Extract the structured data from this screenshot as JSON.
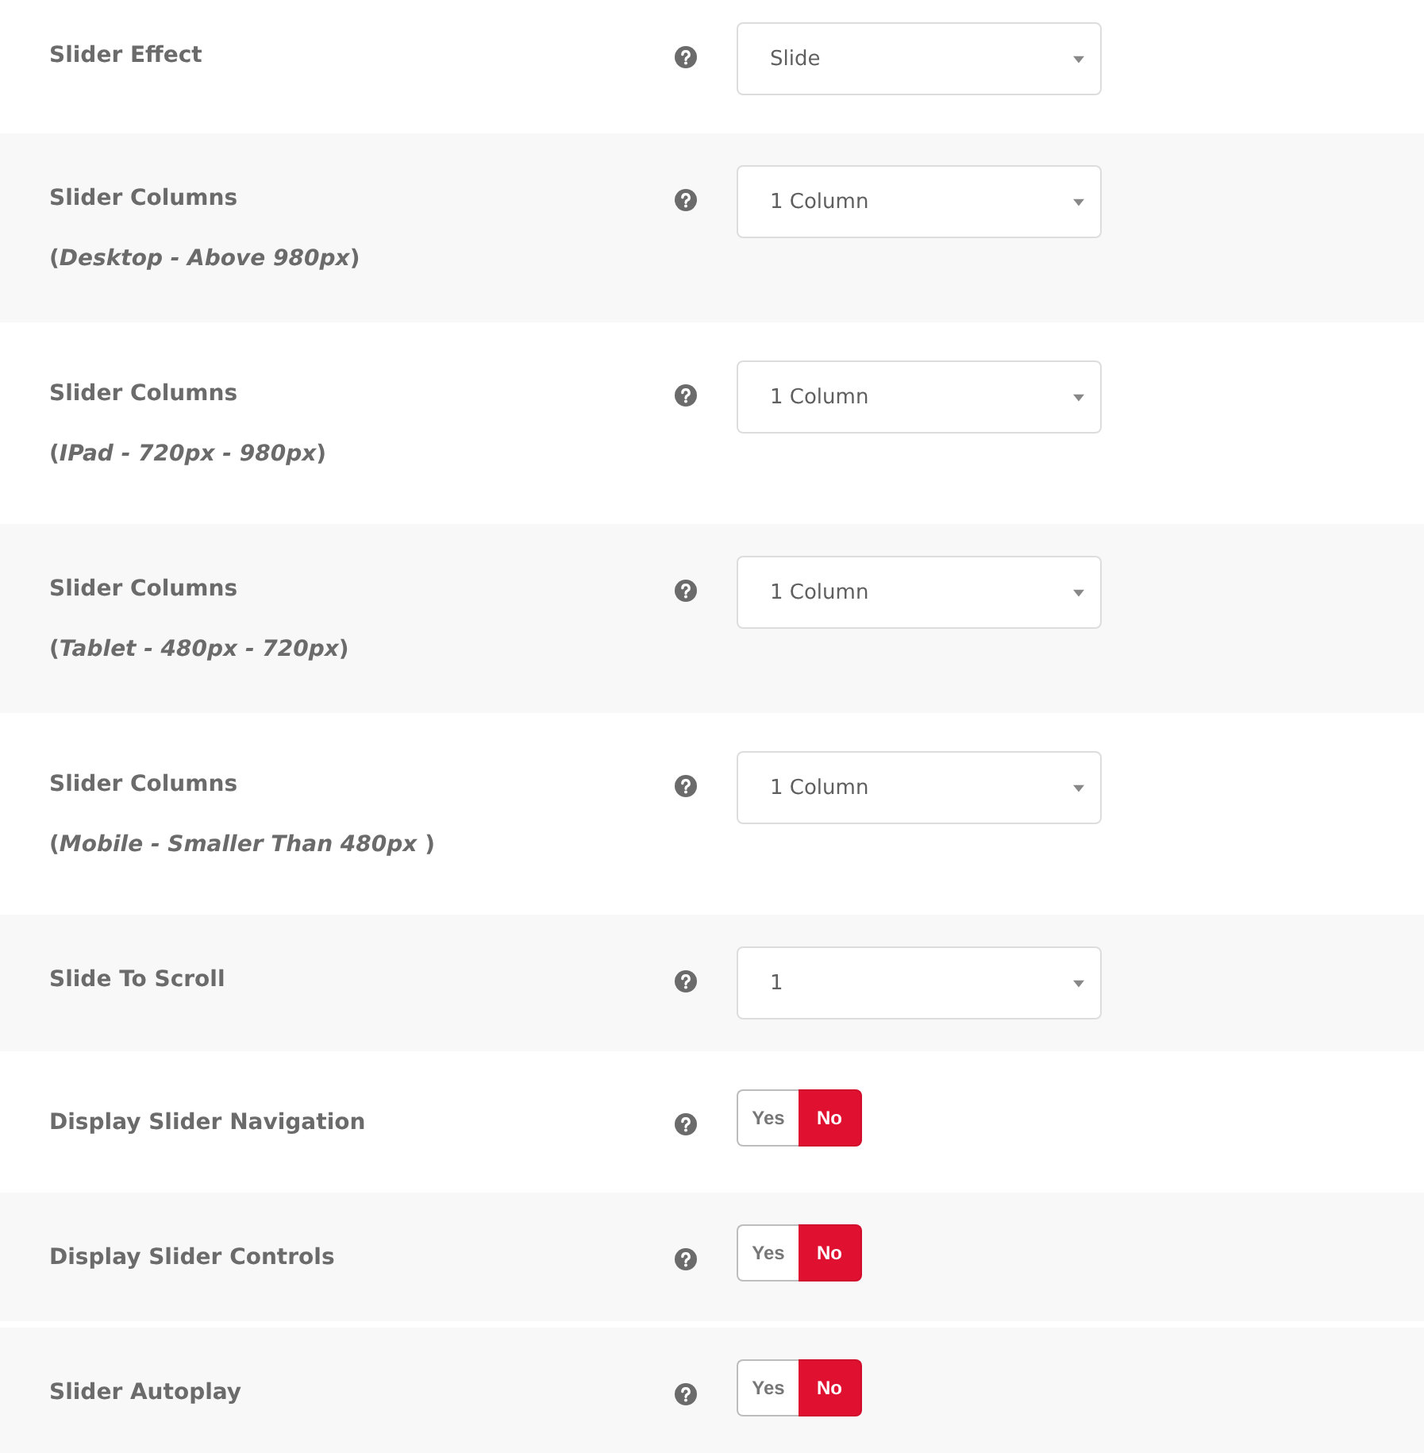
{
  "rows": [
    {
      "kind": "select",
      "label": "Slider Effect",
      "value": "Slide"
    },
    {
      "kind": "select",
      "label": "Slider Columns",
      "note": "(*Desktop - Above 980px*)",
      "value": "1 Column"
    },
    {
      "kind": "select",
      "label": "Slider Columns",
      "note": "(*IPad - 720px - 980px*)",
      "value": "1 Column"
    },
    {
      "kind": "select",
      "label": "Slider Columns",
      "note": "(*Tablet - 480px - 720px*)",
      "value": "1 Column"
    },
    {
      "kind": "select",
      "label": "Slider Columns",
      "note": "(*Mobile - Smaller Than 480px* )",
      "value": "1 Column"
    },
    {
      "kind": "select",
      "label": "Slide To Scroll",
      "value": "1"
    },
    {
      "kind": "toggle",
      "label": "Display Slider Navigation",
      "options": [
        {
          "label": "Yes",
          "selected": false
        },
        {
          "label": "No",
          "selected": true
        }
      ]
    },
    {
      "kind": "toggle",
      "label": "Display Slider Controls",
      "options": [
        {
          "label": "Yes",
          "selected": false
        },
        {
          "label": "No",
          "selected": true
        }
      ]
    },
    {
      "kind": "toggle",
      "label": "Slider Autoplay",
      "options": [
        {
          "label": "Yes",
          "selected": false
        },
        {
          "label": "No",
          "selected": true
        }
      ]
    }
  ]
}
